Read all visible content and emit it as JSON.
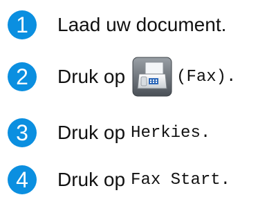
{
  "colors": {
    "step_circle": "#0b8fe0",
    "text": "#111111",
    "icon_bg_top": "#8b9096",
    "icon_bg_bottom": "#4f555c"
  },
  "steps": [
    {
      "number": "1",
      "text": "Laad uw document."
    },
    {
      "number": "2",
      "text": "Druk op",
      "icon": "fax-icon",
      "code": "(Fax)."
    },
    {
      "number": "3",
      "text": "Druk op",
      "code": "Herkies."
    },
    {
      "number": "4",
      "text": "Druk op",
      "code": "Fax Start."
    }
  ]
}
